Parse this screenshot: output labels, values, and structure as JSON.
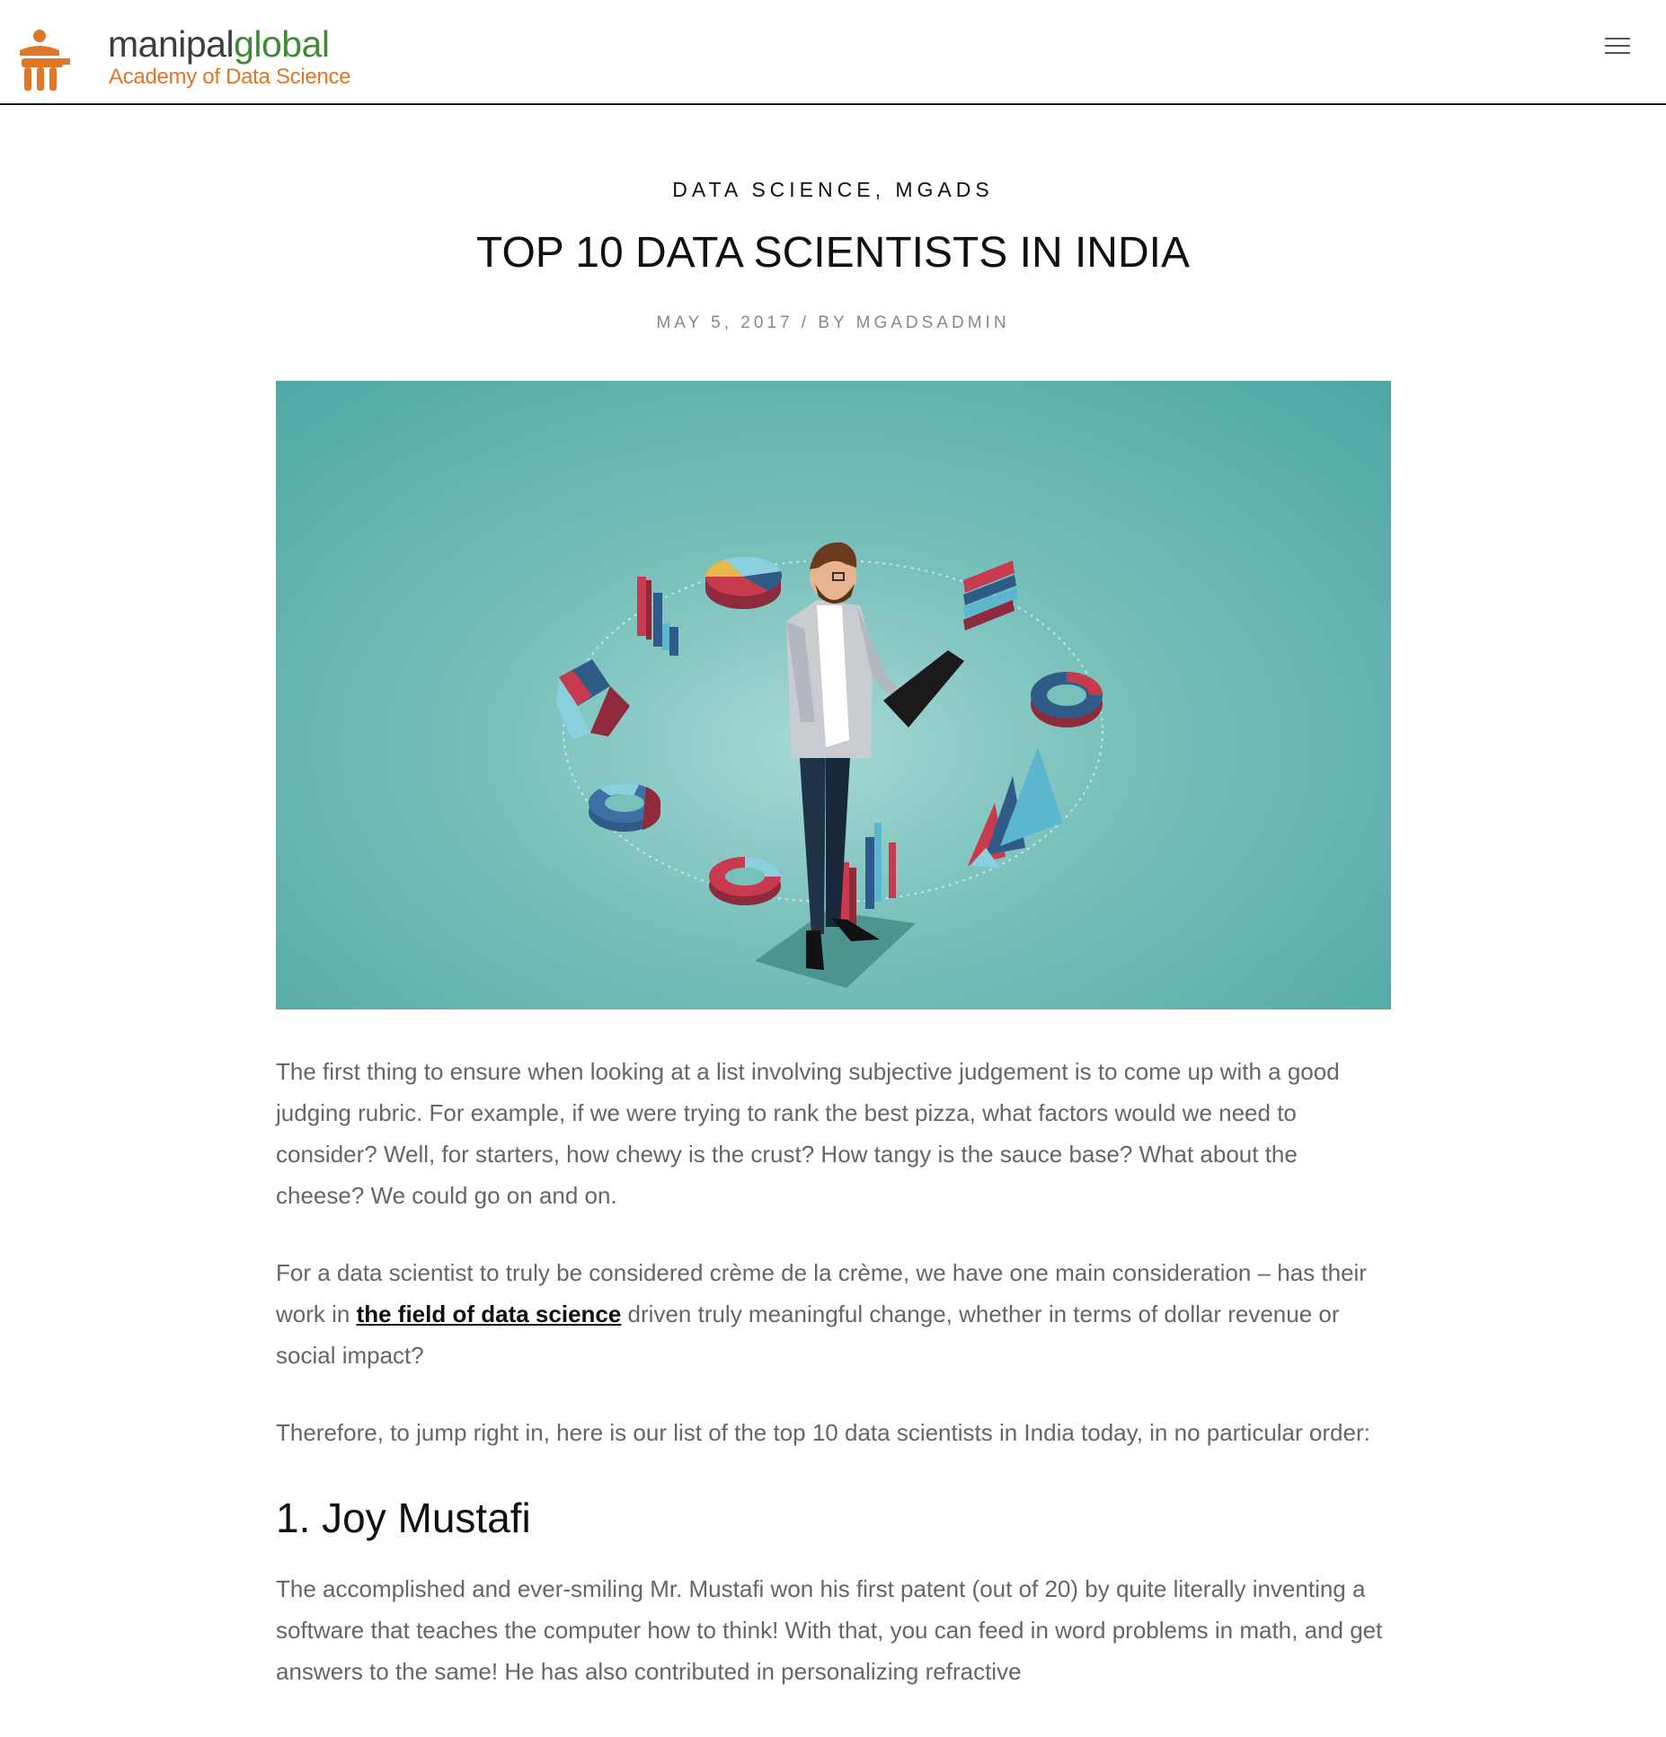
{
  "header": {
    "logo_word1": "manipal",
    "logo_word2": "global",
    "logo_tagline": "Academy of Data Science",
    "menu_icon": "hamburger-menu-icon"
  },
  "post": {
    "categories": [
      "DATA SCIENCE",
      "MGADS"
    ],
    "category_separator": ", ",
    "title": "TOP 10 DATA SCIENTISTS IN INDIA",
    "date": "MAY 5, 2017",
    "meta_separator": " / BY ",
    "author": "MGADSADMIN"
  },
  "content": {
    "p1": "The first thing to ensure when looking at a list involving subjective judgement is to come up with a good judging rubric. For example, if we were trying to rank the best pizza, what factors would we need to consider? Well, for starters, how chewy is the crust? How tangy is the sauce base? What about the cheese? We could go on and on.",
    "p2_before": "For a data scientist to truly be considered crème de la crème, we have one main consideration – has their work in ",
    "p2_link": "the field of data science",
    "p2_after": " driven truly meaningful change, whether in terms of dollar revenue or social impact?",
    "p3": "Therefore, to jump right in, here is our list of the top 10 data scientists in India today, in no particular order:",
    "h2_1": "1. Joy Mustafi",
    "p4": "The accomplished and ever-smiling Mr. Mustafi won his first patent (out of 20) by quite literally inventing a software that teaches the computer how to think! With that, you can feed in word problems in math, and get answers to the same! He has also contributed in personalizing refractive"
  },
  "colors": {
    "logo_gray": "#3d3d3d",
    "logo_green": "#3e8a36",
    "logo_orange": "#e07628",
    "image_teal": "#4ea7a3",
    "link": "#111111",
    "body_text": "#666666"
  }
}
